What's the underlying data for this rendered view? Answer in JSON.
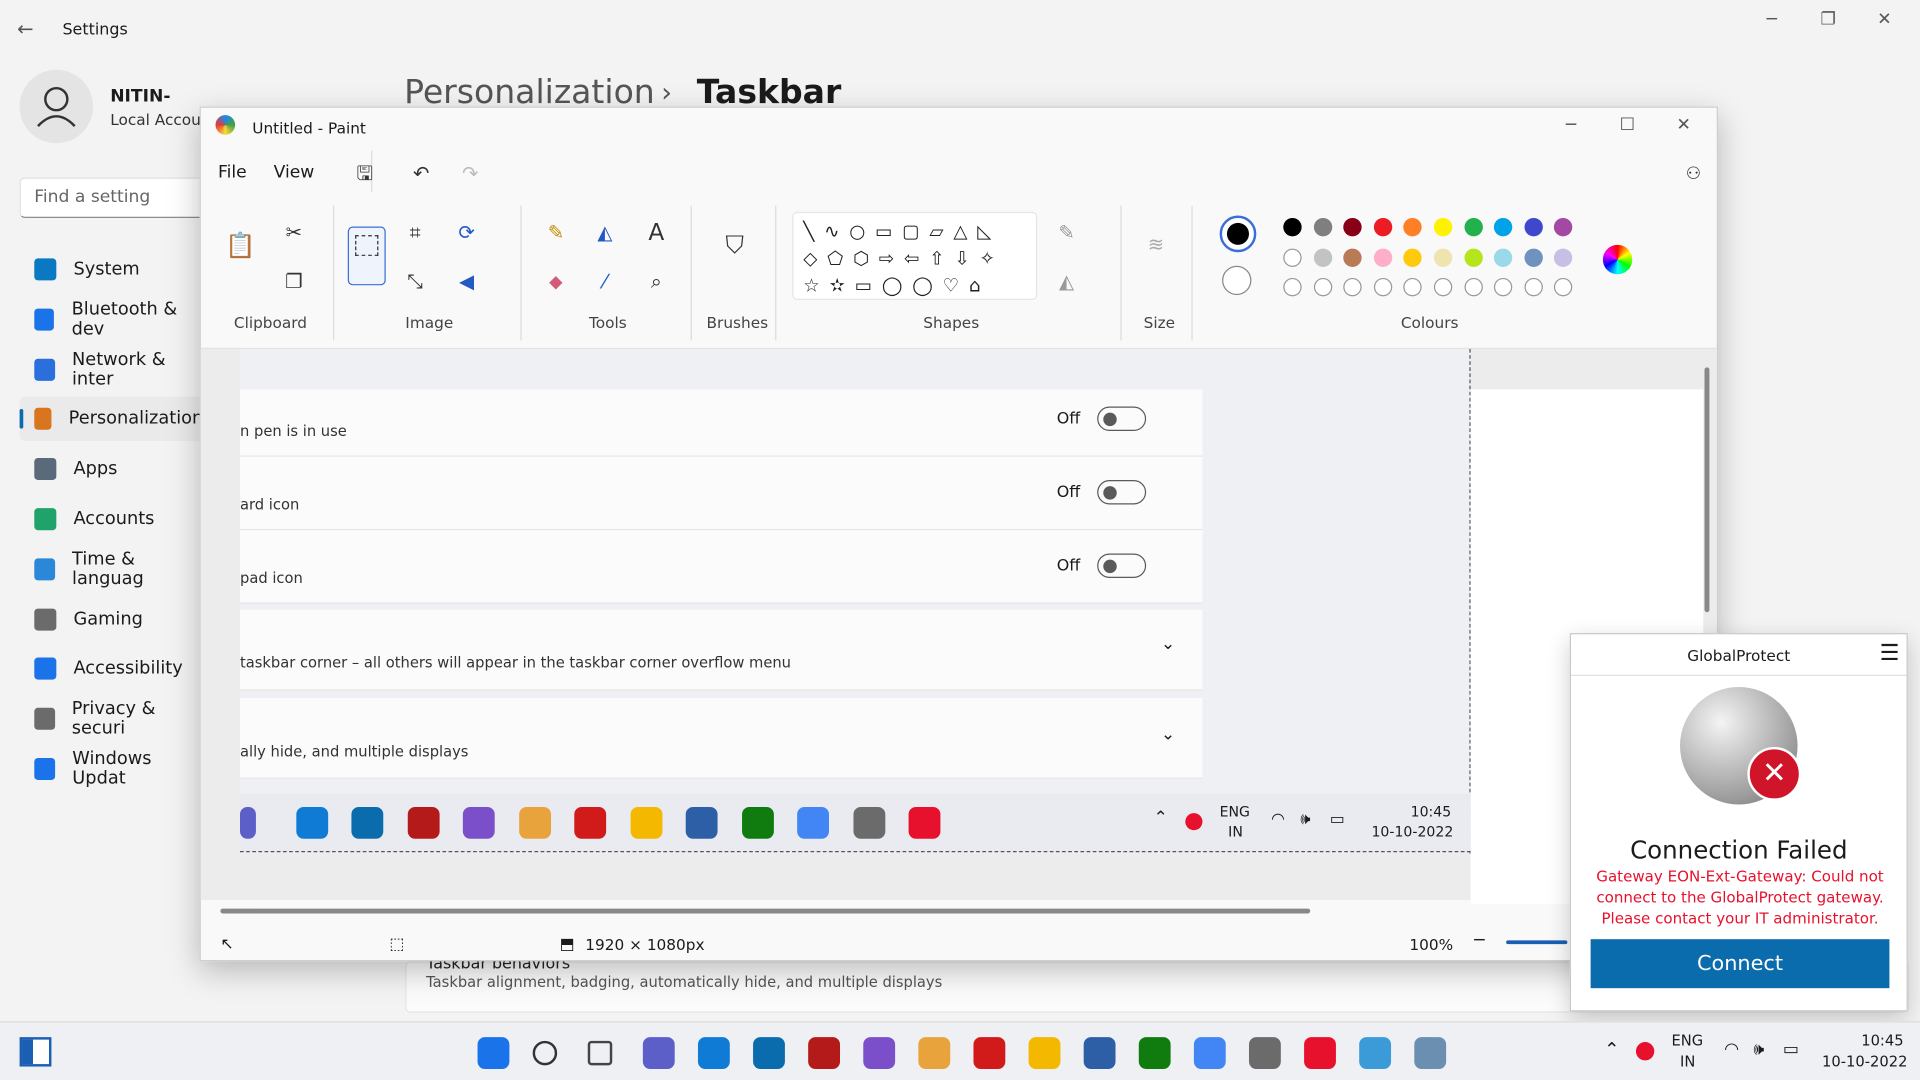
{
  "settings": {
    "title": "Settings",
    "user_name": "NITIN-",
    "user_type": "Local Accoun",
    "search_placeholder": "Find a setting",
    "breadcrumb_parent": "Personalization",
    "breadcrumb_sep": "›",
    "breadcrumb_current": "Taskbar",
    "nav": [
      {
        "label": "System",
        "icon": "monitor-icon",
        "color": "#0a78c2"
      },
      {
        "label": "Bluetooth & dev",
        "icon": "bluetooth-icon",
        "color": "#1a73e8"
      },
      {
        "label": "Network & inter",
        "icon": "wifi-icon",
        "color": "#2a6fdb"
      },
      {
        "label": "Personalization",
        "icon": "brush-icon",
        "color": "#d9751e"
      },
      {
        "label": "Apps",
        "icon": "apps-icon",
        "color": "#5a6a7a"
      },
      {
        "label": "Accounts",
        "icon": "person-icon",
        "color": "#1fa36a"
      },
      {
        "label": "Time & languag",
        "icon": "clock-globe-icon",
        "color": "#2b88d8"
      },
      {
        "label": "Gaming",
        "icon": "gamepad-icon",
        "color": "#6b6b6b"
      },
      {
        "label": "Accessibility",
        "icon": "accessibility-icon",
        "color": "#1a73e8"
      },
      {
        "label": "Privacy & securi",
        "icon": "shield-icon",
        "color": "#6b6b6b"
      },
      {
        "label": "Windows Updat",
        "icon": "update-icon",
        "color": "#1a73e8"
      }
    ],
    "bg_behaviors_title": "Taskbar behaviors",
    "bg_behaviors_desc": "Taskbar alignment, badging, automatically hide, and multiple displays"
  },
  "paint": {
    "title": "Untitled - Paint",
    "menu": [
      "File",
      "View"
    ],
    "groups": {
      "clipboard": "Clipboard",
      "image": "Image",
      "tools": "Tools",
      "brushes": "Brushes",
      "shapes": "Shapes",
      "size": "Size",
      "colours": "Colours"
    },
    "colours_row1": [
      "#000000",
      "#7f7f7f",
      "#880015",
      "#ed1c24",
      "#ff7f27",
      "#fff200",
      "#22b14c",
      "#00a2e8",
      "#3f48cc",
      "#a349a4"
    ],
    "colours_row2": [
      "#ffffff",
      "#c3c3c3",
      "#b97a57",
      "#ffaec9",
      "#ffc90e",
      "#efe4b0",
      "#b5e61d",
      "#99d9ea",
      "#7092be",
      "#c8bfe7"
    ],
    "status_canvas": "1920 × 1080px",
    "zoom": "100%",
    "canvas_rows": [
      {
        "text": "n pen is in use",
        "state": "Off"
      },
      {
        "text": "ard icon",
        "state": "Off"
      },
      {
        "text": "pad icon",
        "state": "Off"
      }
    ],
    "canvas_expanders": [
      "taskbar corner – all others will appear in the taskbar corner overflow menu",
      "ally hide, and multiple displays"
    ],
    "canvas_tray": {
      "lang1": "ENG",
      "lang2": "IN",
      "time": "10:45",
      "date": "10-10-2022"
    }
  },
  "globalprotect": {
    "title": "GlobalProtect",
    "status_title": "Connection Failed",
    "message": "Gateway EON-Ext-Gateway: Could not connect to the GlobalProtect gateway. Please contact your IT administrator.",
    "button": "Connect",
    "error_color": "#e8112d",
    "button_color": "#0a6cad"
  },
  "taskbar": {
    "lang1": "ENG",
    "lang2": "IN",
    "time": "10:45",
    "date": "10-10-2022"
  }
}
